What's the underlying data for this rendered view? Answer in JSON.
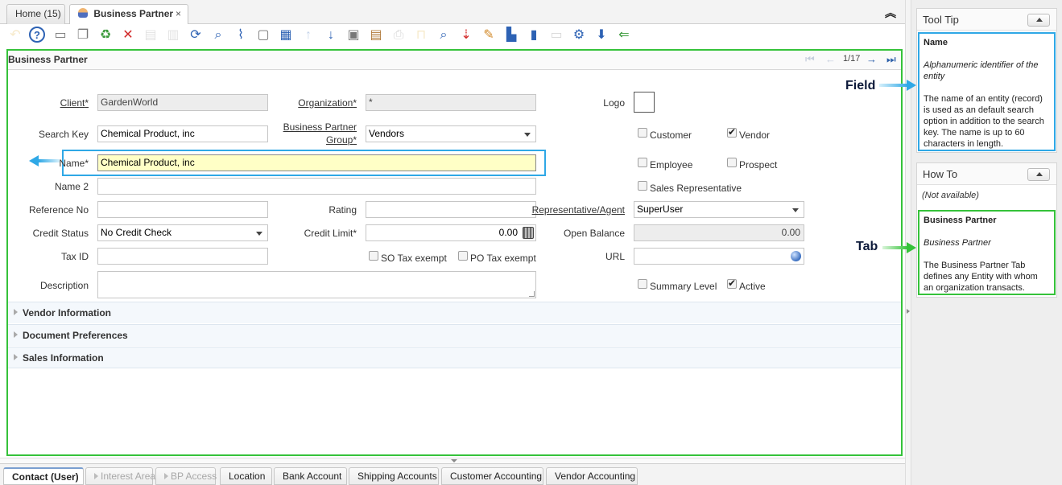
{
  "window_tabs": [
    {
      "label": "Home (15)",
      "active": false
    },
    {
      "label": "Business Partner",
      "active": true,
      "close_symbol": "×"
    }
  ],
  "toolbar_icons": [
    {
      "name": "undo-icon",
      "glyph": "↶",
      "color": "#e3b646",
      "enabled": false
    },
    {
      "name": "help-icon",
      "glyph": "?",
      "color": "#2d62b4",
      "enabled": true
    },
    {
      "name": "new-record-icon",
      "glyph": "▭",
      "color": "#777777",
      "enabled": true
    },
    {
      "name": "copy-record-icon",
      "glyph": "❐",
      "color": "#777777",
      "enabled": true
    },
    {
      "name": "delete-record-icon",
      "glyph": "♻",
      "color": "#3b9a3b",
      "enabled": true
    },
    {
      "name": "delete-selection-icon",
      "glyph": "✕",
      "color": "#d22a2a",
      "enabled": true
    },
    {
      "name": "save-icon",
      "glyph": "▤",
      "color": "#999999",
      "enabled": false
    },
    {
      "name": "save-new-icon",
      "glyph": "▥",
      "color": "#999999",
      "enabled": false
    },
    {
      "name": "refresh-icon",
      "glyph": "⟳",
      "color": "#2d62b4",
      "enabled": true
    },
    {
      "name": "find-icon",
      "glyph": "⌕",
      "color": "#2d62b4",
      "enabled": true
    },
    {
      "name": "attachment-icon",
      "glyph": "⌇",
      "color": "#2d62b4",
      "enabled": true
    },
    {
      "name": "chat-icon",
      "glyph": "▢",
      "color": "#777777",
      "enabled": true
    },
    {
      "name": "grid-toggle-icon",
      "glyph": "▦",
      "color": "#2d62b4",
      "enabled": true
    },
    {
      "name": "parent-record-icon",
      "glyph": "↑",
      "color": "#2d62b4",
      "enabled": false
    },
    {
      "name": "detail-record-icon",
      "glyph": "↓",
      "color": "#2d62b4",
      "enabled": true
    },
    {
      "name": "report-icon",
      "glyph": "▣",
      "color": "#777777",
      "enabled": true
    },
    {
      "name": "archive-icon",
      "glyph": "▤",
      "color": "#b0793a",
      "enabled": true
    },
    {
      "name": "print-icon",
      "glyph": "⎙",
      "color": "#777777",
      "enabled": false
    },
    {
      "name": "lock-icon",
      "glyph": "⊓",
      "color": "#e3b646",
      "enabled": false
    },
    {
      "name": "zoom-across-icon",
      "glyph": "⌕",
      "color": "#2d62b4",
      "enabled": true
    },
    {
      "name": "active-workflows-icon",
      "glyph": "⇣",
      "color": "#d22a2a",
      "enabled": true
    },
    {
      "name": "request-icon",
      "glyph": "✎",
      "color": "#d28a2a",
      "enabled": true
    },
    {
      "name": "product-info-icon",
      "glyph": "▙",
      "color": "#2d62b4",
      "enabled": true
    },
    {
      "name": "export-icon",
      "glyph": "▮",
      "color": "#2d62b4",
      "enabled": true
    },
    {
      "name": "file-import-icon",
      "glyph": "▭",
      "color": "#777777",
      "enabled": false
    },
    {
      "name": "customize-icon",
      "glyph": "⚙",
      "color": "#2d62b4",
      "enabled": true
    },
    {
      "name": "process-icon",
      "glyph": "⬇",
      "color": "#2d62b4",
      "enabled": true
    },
    {
      "name": "end-icon",
      "glyph": "⇐",
      "color": "#3b9a3b",
      "enabled": true
    }
  ],
  "collapse_symbol": "︽",
  "panel": {
    "title": "Business Partner",
    "record_counter": "1/17",
    "nav": {
      "first": "⏮",
      "previous": "←",
      "next": "→",
      "last": "⏭"
    }
  },
  "form": {
    "client": {
      "label": "Client",
      "value": "GardenWorld"
    },
    "organization": {
      "label": "Organization",
      "value": "*"
    },
    "logo": {
      "label": "Logo"
    },
    "search_key": {
      "label": "Search Key",
      "value": "Chemical Product, inc"
    },
    "bp_group": {
      "label": "Business Partner Group",
      "value": "Vendors"
    },
    "name": {
      "label": "Name",
      "value": "Chemical Product, inc"
    },
    "name2": {
      "label": "Name 2",
      "value": ""
    },
    "reference_no": {
      "label": "Reference No",
      "value": ""
    },
    "rating": {
      "label": "Rating",
      "value": ""
    },
    "representative": {
      "label": "Representative/Agent",
      "value": "SuperUser"
    },
    "credit_status": {
      "label": "Credit Status",
      "value": "No Credit Check"
    },
    "credit_limit": {
      "label": "Credit Limit",
      "value": "0.00"
    },
    "open_balance": {
      "label": "Open Balance",
      "value": "0.00"
    },
    "tax_id": {
      "label": "Tax ID",
      "value": ""
    },
    "url": {
      "label": "URL",
      "value": ""
    },
    "description": {
      "label": "Description",
      "value": ""
    },
    "required_mark": "*",
    "checkboxes": {
      "customer": {
        "label": "Customer",
        "checked": false
      },
      "vendor": {
        "label": "Vendor",
        "checked": true
      },
      "employee": {
        "label": "Employee",
        "checked": false
      },
      "prospect": {
        "label": "Prospect",
        "checked": false
      },
      "sales_rep": {
        "label": "Sales Representative",
        "checked": false
      },
      "so_tax_exempt": {
        "label": "SO Tax exempt",
        "checked": false
      },
      "po_tax_exempt": {
        "label": "PO Tax exempt",
        "checked": false
      },
      "summary_level": {
        "label": "Summary Level",
        "checked": false
      },
      "active": {
        "label": "Active",
        "checked": true
      }
    }
  },
  "sections": [
    "Vendor Information",
    "Document Preferences",
    "Sales Information"
  ],
  "bottom_tabs": [
    {
      "label": "Contact (User)",
      "state": "active"
    },
    {
      "label": "Interest Area",
      "state": "disabled"
    },
    {
      "label": "BP Access",
      "state": "disabled"
    },
    {
      "label": "Location",
      "state": "normal"
    },
    {
      "label": "Bank Account",
      "state": "normal"
    },
    {
      "label": "Shipping Accounts",
      "state": "normal"
    },
    {
      "label": "Customer Accounting",
      "state": "normal"
    },
    {
      "label": "Vendor Accounting",
      "state": "normal"
    }
  ],
  "tooltip_panel": {
    "title": "Tool Tip",
    "field_name": "Name",
    "field_description": "Alphanumeric identifier of the entity",
    "field_help": "The name of an entity (record) is used as an default search option in addition to the search key. The name is up to 60 characters in length."
  },
  "howto_panel": {
    "title": "How To",
    "not_available": "(Not available)",
    "tab_name": "Business Partner",
    "tab_description": "Business Partner",
    "tab_help": "The Business Partner Tab defines any Entity with whom an organization transacts."
  },
  "annotations": {
    "field_label": "Field",
    "tab_label": "Tab"
  },
  "colors": {
    "annotation_blue": "#2fa8e6",
    "annotation_green": "#35c23a"
  }
}
